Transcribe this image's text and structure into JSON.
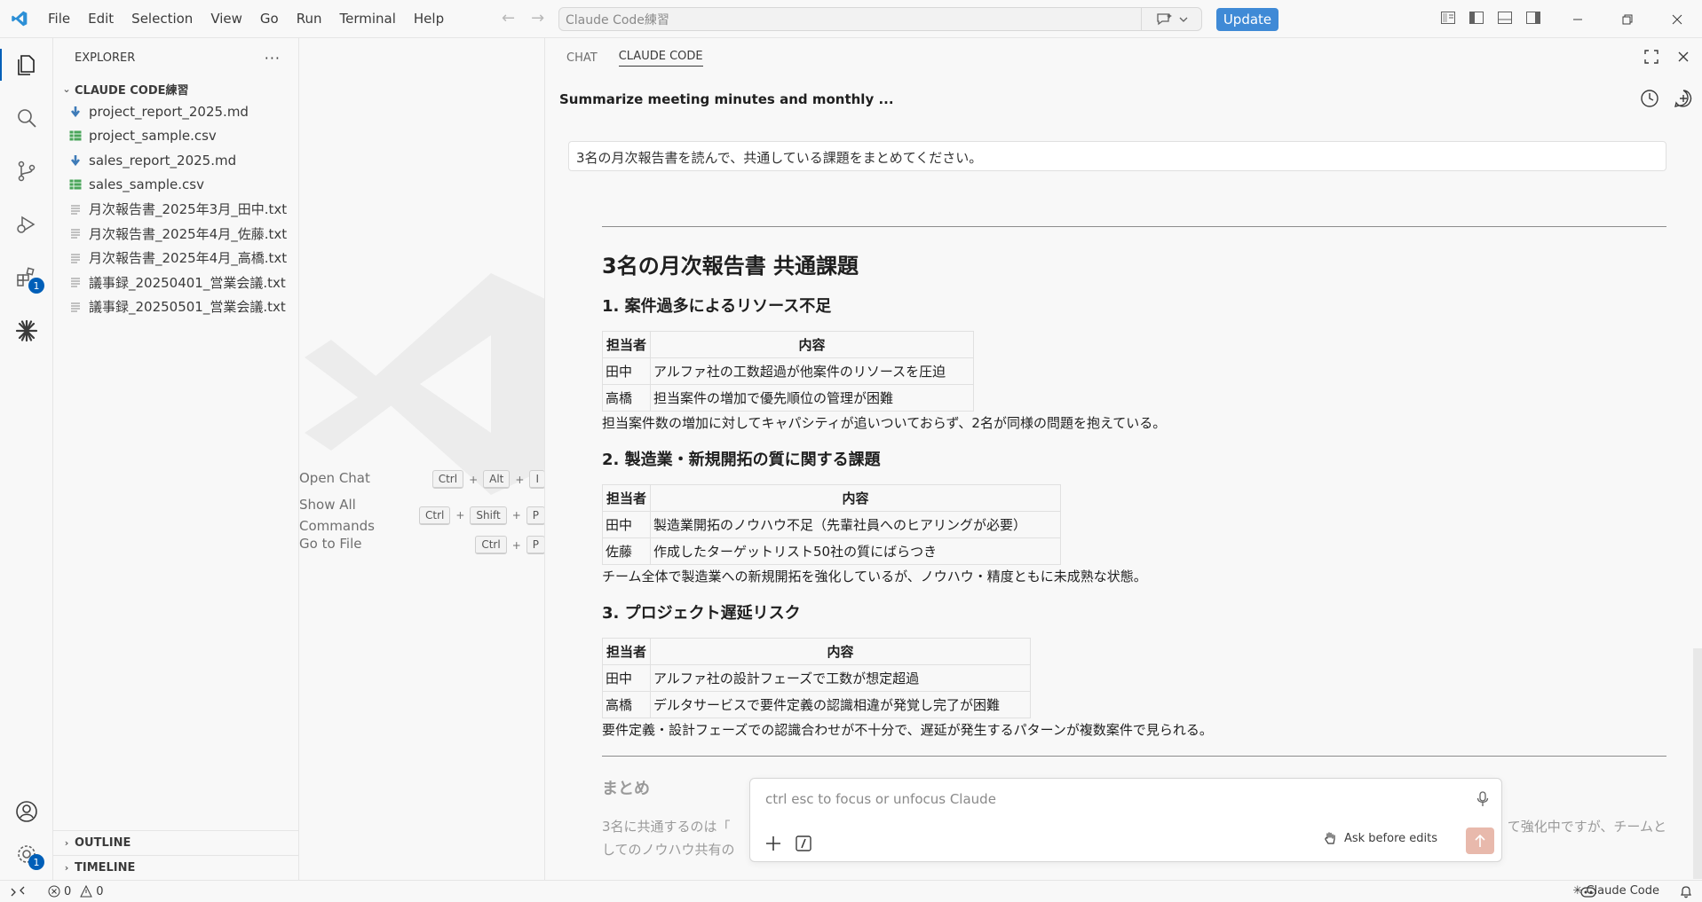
{
  "menu": [
    "File",
    "Edit",
    "Selection",
    "View",
    "Go",
    "Run",
    "Terminal",
    "Help"
  ],
  "search": {
    "placeholder": "Claude Code練習"
  },
  "update_label": "Update",
  "sidebar": {
    "title": "EXPLORER",
    "folder": "CLAUDE CODE練習",
    "files": [
      {
        "name": "project_report_2025.md",
        "icon": "markdown-icon"
      },
      {
        "name": "project_sample.csv",
        "icon": "csv-icon"
      },
      {
        "name": "sales_report_2025.md",
        "icon": "markdown-icon"
      },
      {
        "name": "sales_sample.csv",
        "icon": "csv-icon"
      },
      {
        "name": "月次報告書_2025年3月_田中.txt",
        "icon": "text-file-icon"
      },
      {
        "name": "月次報告書_2025年4月_佐藤.txt",
        "icon": "text-file-icon"
      },
      {
        "name": "月次報告書_2025年4月_高橋.txt",
        "icon": "text-file-icon"
      },
      {
        "name": "議事録_20250401_営業会議.txt",
        "icon": "text-file-icon"
      },
      {
        "name": "議事録_20250501_営業会議.txt",
        "icon": "text-file-icon"
      }
    ],
    "outline": "OUTLINE",
    "timeline": "TIMELINE"
  },
  "activity": {
    "extensions_badge": "1",
    "accounts_badge": "1"
  },
  "shortcuts": [
    {
      "label": "Open Chat",
      "keys": [
        "Ctrl",
        "Alt",
        "I"
      ]
    },
    {
      "label": "Show All Commands",
      "keys": [
        "Ctrl",
        "Shift",
        "P"
      ]
    },
    {
      "label": "Go to File",
      "keys": [
        "Ctrl",
        "P"
      ]
    }
  ],
  "panel": {
    "tabs": [
      "CHAT",
      "CLAUDE CODE"
    ],
    "conversation_title": "Summarize meeting minutes and monthly ...",
    "user_message": "3名の月次報告書を読んで、共通している課題をまとめてください。",
    "heading": "3名の月次報告書 共通課題",
    "table_headers": [
      "担当者",
      "内容"
    ],
    "sections": [
      {
        "title": "1. 案件過多によるリソース不足",
        "rows": [
          [
            "田中",
            "アルファ社の工数超過が他案件のリソースを圧迫"
          ],
          [
            "高橋",
            "担当案件の増加で優先順位の管理が困難"
          ]
        ],
        "summary": "担当案件数の増加に対してキャパシティが追いついておらず、2名が同様の問題を抱えている。"
      },
      {
        "title": "2. 製造業・新規開拓の質に関する課題",
        "rows": [
          [
            "田中",
            "製造業開拓のノウハウ不足（先輩社員へのヒアリングが必要）"
          ],
          [
            "佐藤",
            "作成したターゲットリスト50社の質にばらつき"
          ]
        ],
        "summary": "チーム全体で製造業への新規開拓を強化しているが、ノウハウ・精度ともに未成熟な状態。"
      },
      {
        "title": "3. プロジェクト遅延リスク",
        "rows": [
          [
            "田中",
            "アルファ社の設計フェーズで工数が想定超過"
          ],
          [
            "高橋",
            "デルタサービスで要件定義の認識相違が発覚し完了が困難"
          ]
        ],
        "summary": "要件定義・設計フェーズでの認識合わせが不十分で、遅延が発生するパターンが複数案件で見られる。"
      }
    ],
    "conclusion_title": "まとめ",
    "conclusion_line1_start": "3名に共通するのは「",
    "conclusion_line1_end": "て強化中ですが、チームと",
    "conclusion_line2": "してのノウハウ共有の"
  },
  "input": {
    "placeholder": "ctrl esc to focus or unfocus Claude",
    "mode_label": "Ask before edits"
  },
  "status": {
    "errors": "0",
    "warnings": "0",
    "claude_label": "Claude Code"
  },
  "colors": {
    "accent": "#005fb8",
    "update": "#3f8ad6",
    "send": "#e8b9ac",
    "vscode_blue": "#2c8fd6"
  }
}
